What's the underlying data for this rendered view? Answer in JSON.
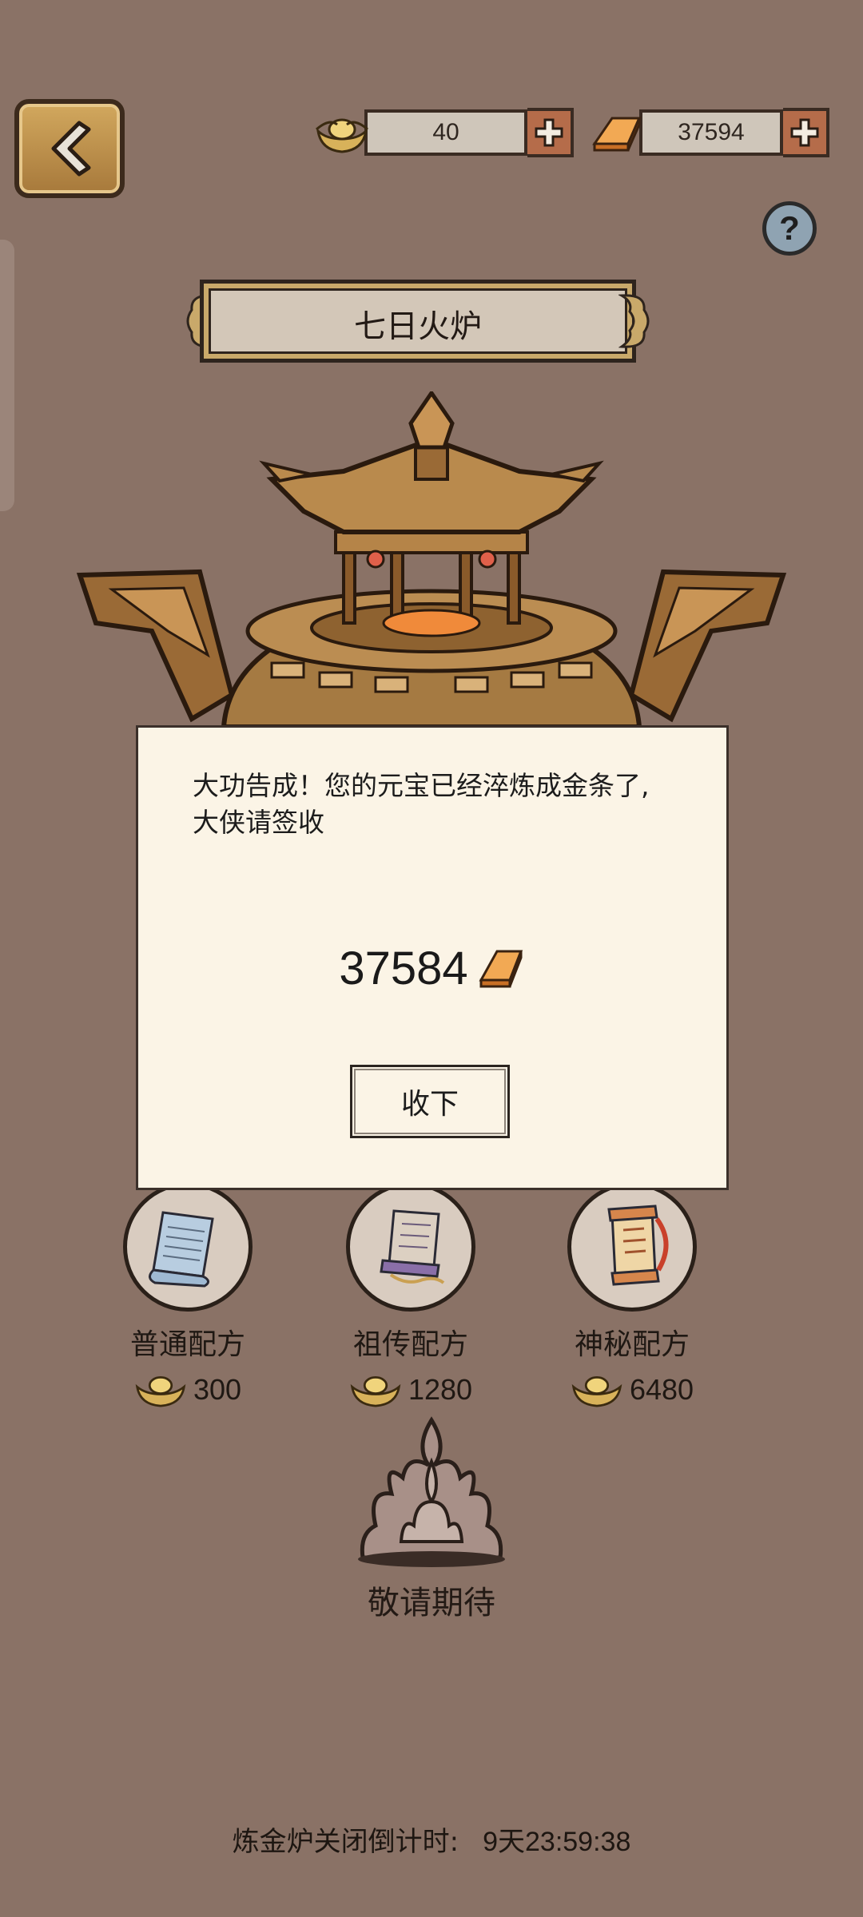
{
  "header": {
    "ingot_count": "40",
    "gold_count": "37594"
  },
  "title": "七日火炉",
  "help_label": "?",
  "modal": {
    "message": "大功告成！您的元宝已经淬炼成金条了,大侠请签收",
    "amount": "37584",
    "collect_label": "收下"
  },
  "recipes": [
    {
      "name": "普通配方",
      "price": "300",
      "icon": "blue-scroll-icon"
    },
    {
      "name": "祖传配方",
      "price": "1280",
      "icon": "purple-scroll-icon"
    },
    {
      "name": "神秘配方",
      "price": "6480",
      "icon": "red-scroll-icon"
    }
  ],
  "coming_soon": "敬请期待",
  "countdown": {
    "label": "炼金炉关闭倒计时:",
    "value": "9天23:59:38"
  },
  "colors": {
    "background": "#8a7266",
    "modal_bg": "#fbf4e6",
    "gold_bar": "#e58f3a",
    "ingot": "#d8b25a"
  }
}
